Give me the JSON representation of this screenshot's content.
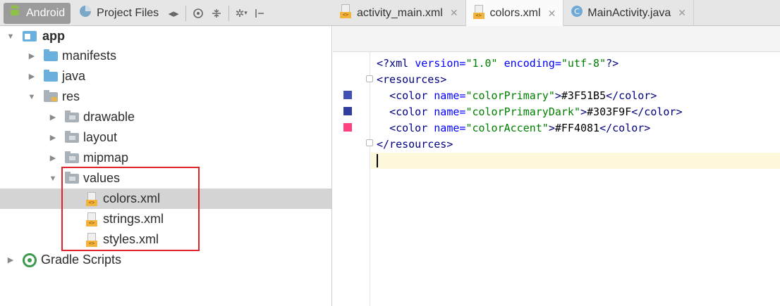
{
  "toolbar": {
    "android_view": "Android",
    "project_files_view": "Project Files"
  },
  "tabs": [
    {
      "label": "activity_main.xml",
      "active": false
    },
    {
      "label": "colors.xml",
      "active": true
    },
    {
      "label": "MainActivity.java",
      "active": false
    }
  ],
  "tree": {
    "app": "app",
    "manifests": "manifests",
    "java": "java",
    "res": "res",
    "drawable": "drawable",
    "layout": "layout",
    "mipmap": "mipmap",
    "values": "values",
    "colors": "colors.xml",
    "strings": "strings.xml",
    "styles": "styles.xml",
    "gradle": "Gradle Scripts"
  },
  "editor": {
    "line1": {
      "open": "<?xml ",
      "a1": "version=",
      "v1": "\"1.0\"",
      "sp": " ",
      "a2": "encoding=",
      "v2": "\"utf-8\"",
      "close": "?>"
    },
    "line2": {
      "tag": "<resources>"
    },
    "colors": [
      {
        "open": "<color ",
        "attr": "name=",
        "name": "\"colorPrimary\"",
        "gt": ">",
        "value": "#3F51B5",
        "close": "</color>",
        "swatch": "#3F51B5"
      },
      {
        "open": "<color ",
        "attr": "name=",
        "name": "\"colorPrimaryDark\"",
        "gt": ">",
        "value": "#303F9F",
        "close": "</color>",
        "swatch": "#303F9F"
      },
      {
        "open": "<color ",
        "attr": "name=",
        "name": "\"colorAccent\"",
        "gt": ">",
        "value": "#FF4081",
        "close": "</color>",
        "swatch": "#FF4081"
      }
    ],
    "line6": {
      "tag": "</resources>"
    }
  }
}
